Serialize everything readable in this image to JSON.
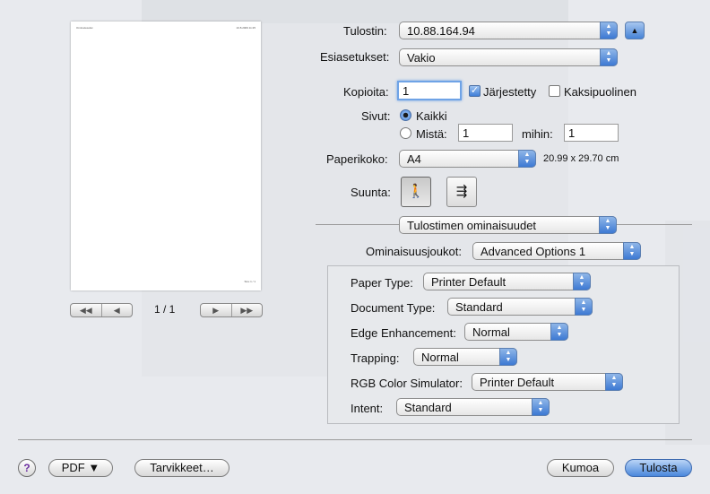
{
  "window": {
    "preview": {
      "header_left": "Ominaisuudet",
      "header_right": "10.8.2009 11:25",
      "footer": "Sivu 1 / 1",
      "page_label": "1 / 1",
      "nav_first": "◀◀",
      "nav_prev": "◀",
      "nav_next": "▶",
      "nav_last": "▶▶"
    },
    "printer": {
      "label": "Tulostin:",
      "value": "10.88.164.94",
      "disclosure": "▲"
    },
    "presets": {
      "label": "Esiasetukset:",
      "value": "Vakio"
    },
    "copies": {
      "label": "Kopioita:",
      "value": "1",
      "collated_label": "Järjestetty",
      "collated_checked": true,
      "duplex_label": "Kaksipuolinen",
      "duplex_checked": false
    },
    "pages": {
      "label": "Sivut:",
      "all_label": "Kaikki",
      "from_label": "Mistä:",
      "from_value": "1",
      "to_label": "mihin:",
      "to_value": "1"
    },
    "paper_size": {
      "label": "Paperikoko:",
      "value": "A4",
      "dimensions": "20.99 x 29.70 cm"
    },
    "orientation": {
      "label": "Suunta:",
      "portrait_glyph": "🚶",
      "landscape_glyph": "⇶"
    },
    "section": {
      "value": "Tulostimen ominaisuudet"
    },
    "feature_sets": {
      "label": "Ominaisuusjoukot:",
      "value": "Advanced Options 1"
    },
    "options": [
      {
        "label": "Paper Type:",
        "value": "Printer Default"
      },
      {
        "label": "Document Type:",
        "value": "Standard"
      },
      {
        "label": "Edge Enhancement:",
        "value": "Normal"
      },
      {
        "label": "Trapping:",
        "value": "Normal"
      },
      {
        "label": "RGB Color Simulator:",
        "value": "Printer Default"
      },
      {
        "label": "Intent:",
        "value": "Standard"
      }
    ],
    "footer": {
      "help": "?",
      "pdf": "PDF ▼",
      "supplies": "Tarvikkeet…",
      "cancel": "Kumoa",
      "print": "Tulosta"
    }
  }
}
